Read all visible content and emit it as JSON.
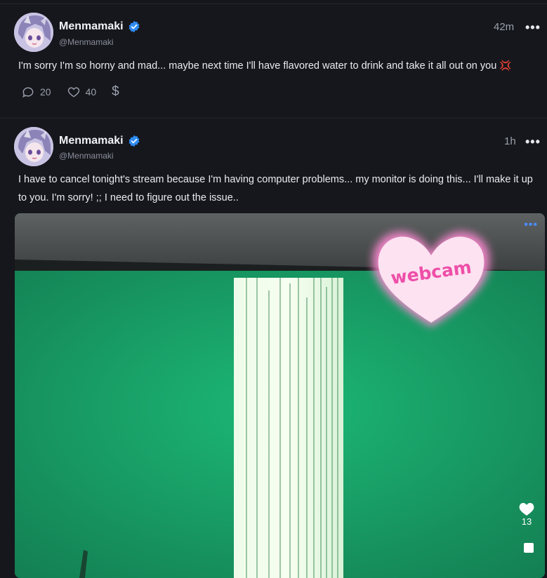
{
  "posts": [
    {
      "author": "Menmamaki",
      "handle": "@Menmamaki",
      "time": "42m",
      "text": "I'm sorry I'm so horny and mad... maybe next time I'll have flavored water to drink and take it all out on you",
      "emoji": "💢",
      "actions": {
        "comments": "20",
        "likes": "40",
        "tip_icon": "$"
      }
    },
    {
      "author": "Menmamaki",
      "handle": "@Menmamaki",
      "time": "1h",
      "text": "I have to cancel tonight's stream because I'm having computer problems... my monitor is doing this... I'll make it up to you. I'm sorry! ;; I need to figure out the issue..",
      "media": {
        "sticker_text": "webcam",
        "like_count": "13"
      }
    }
  ],
  "more_icon": "•••",
  "colors": {
    "background": "#16171c",
    "verified": "#2f8cf5",
    "accent_pink": "#ee4fa8",
    "green_screen": "#1fa56b"
  }
}
